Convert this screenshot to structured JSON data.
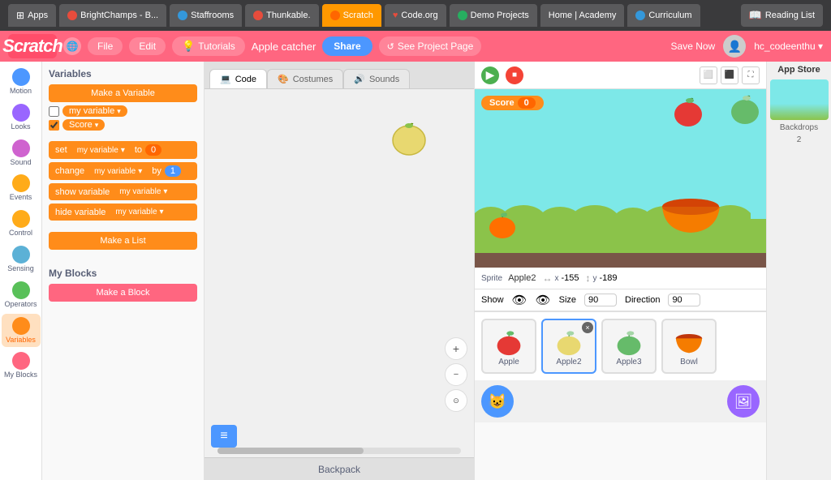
{
  "browser": {
    "tabs": [
      {
        "label": "Apps",
        "icon": "grid"
      },
      {
        "label": "BrightChamps - B...",
        "icon": "bc"
      },
      {
        "label": "Staffrooms",
        "icon": "staff"
      },
      {
        "label": "Thunkable.",
        "icon": "thunk"
      },
      {
        "label": "Scratch",
        "icon": "scratch"
      },
      {
        "label": "Code.org",
        "icon": "code"
      },
      {
        "label": "Demo Projects",
        "icon": "demo"
      },
      {
        "label": "Home | Academy",
        "icon": "home"
      },
      {
        "label": "Curriculum",
        "icon": "curr"
      }
    ],
    "reading_list": "Reading List"
  },
  "scratch": {
    "logo": "Scratch",
    "nav": {
      "globe_label": "🌐",
      "file_label": "File",
      "edit_label": "Edit",
      "tutorials_label": "Tutorials",
      "project_name": "Apple catcher",
      "share_label": "Share",
      "see_project_label": "See Project Page",
      "save_now_label": "Save Now",
      "username": "hc_codeenthu ▾"
    },
    "tabs": {
      "code": "Code",
      "costumes": "Costumes",
      "sounds": "Sounds"
    },
    "categories": [
      {
        "id": "motion",
        "label": "Motion",
        "color": "motion"
      },
      {
        "id": "looks",
        "label": "Looks",
        "color": "looks"
      },
      {
        "id": "sound",
        "label": "Sound",
        "color": "sound"
      },
      {
        "id": "events",
        "label": "Events",
        "color": "events"
      },
      {
        "id": "control",
        "label": "Control",
        "color": "control"
      },
      {
        "id": "sensing",
        "label": "Sensing",
        "color": "sensing"
      },
      {
        "id": "operators",
        "label": "Operators",
        "color": "operators"
      },
      {
        "id": "variables",
        "label": "Variables",
        "color": "variables"
      },
      {
        "id": "myblocks",
        "label": "My Blocks",
        "color": "myblocks"
      }
    ],
    "blocks": {
      "variables_title": "Variables",
      "make_variable_label": "Make a Variable",
      "var1_name": "my variable",
      "var2_name": "Score",
      "block_set": "set",
      "block_change": "change",
      "block_show": "show variable",
      "block_hide": "hide variable",
      "block_to": "to",
      "block_by": "by",
      "set_val": "0",
      "change_val": "1",
      "make_list_label": "Make a List",
      "my_blocks_title": "My Blocks",
      "make_block_label": "Make a Block"
    },
    "stage": {
      "score_label": "Score",
      "score_val": "0",
      "sprite_label": "Sprite",
      "sprite_name": "Apple2",
      "x_label": "x",
      "x_val": "-155",
      "y_label": "y",
      "y_val": "-189",
      "show_label": "Show",
      "size_label": "Size",
      "size_val": "90",
      "direction_label": "Direction",
      "direction_val": "90"
    },
    "sprites": [
      {
        "name": "Apple",
        "selected": false
      },
      {
        "name": "Apple2",
        "selected": true
      },
      {
        "name": "Apple3",
        "selected": false
      },
      {
        "name": "Bowl",
        "selected": false
      }
    ],
    "backpack_label": "Backpack",
    "app_store": {
      "title": "App Store",
      "backdrop_label": "Backdrops",
      "backdrop_count": "2"
    }
  }
}
